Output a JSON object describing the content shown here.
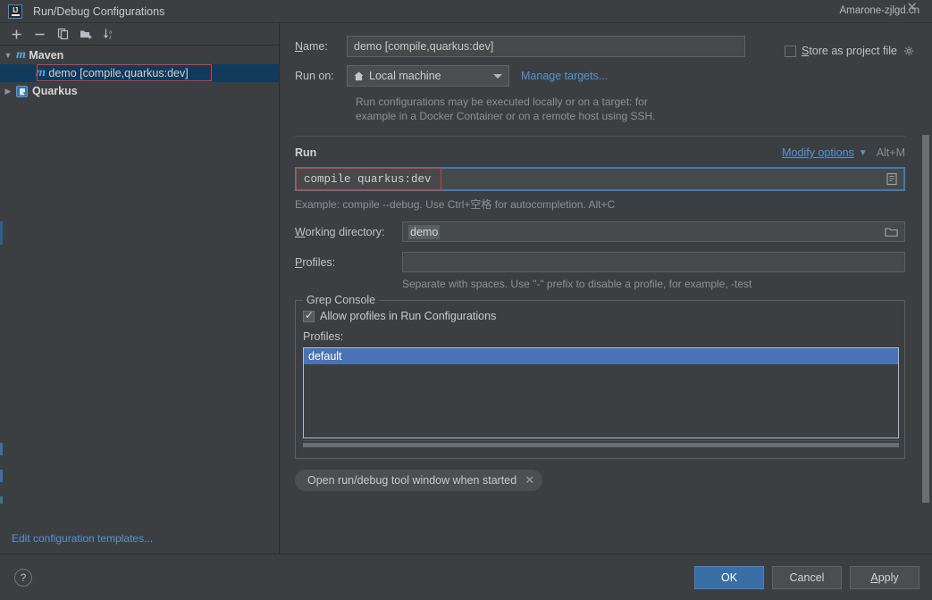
{
  "window": {
    "title": "Run/Debug Configurations",
    "app_icon": "intellij-idea-icon",
    "watermark": "Amarone-zjlgd.cn",
    "close_label": "✕"
  },
  "sidebar": {
    "toolbar": [
      {
        "name": "add-button",
        "glyph": "+"
      },
      {
        "name": "remove-button",
        "glyph": "−"
      },
      {
        "name": "copy-button",
        "glyph": "copy-icon"
      },
      {
        "name": "new-folder-button",
        "glyph": "folder-add-icon"
      },
      {
        "name": "sort-button",
        "glyph": "sort-az-icon"
      }
    ],
    "tree": [
      {
        "label": "Maven",
        "icon": "maven-icon",
        "expanded": true,
        "selected": false,
        "depth": 0
      },
      {
        "label": "demo [compile,quarkus:dev]",
        "icon": "maven-icon",
        "expanded": null,
        "selected": true,
        "depth": 1,
        "highlighted": true
      },
      {
        "label": "Quarkus",
        "icon": "quarkus-icon",
        "expanded": false,
        "selected": false,
        "depth": 0
      }
    ],
    "edit_templates_link": "Edit configuration templates..."
  },
  "form": {
    "name_label": "Name:",
    "name_value": "demo [compile,quarkus:dev]",
    "store_as_project_file_label": "Store as project file",
    "store_as_project_file_checked": false,
    "run_on_label": "Run on:",
    "run_on_value": "Local machine",
    "run_on_icon": "home-icon",
    "manage_targets_link": "Manage targets...",
    "run_on_hint_line1": "Run configurations may be executed locally or on a target: for",
    "run_on_hint_line2": "example in a Docker Container or on a remote host using SSH."
  },
  "run_section": {
    "title": "Run",
    "modify_options_link": "Modify options",
    "modify_options_shortcut": "Alt+M",
    "command_value": "compile quarkus:dev",
    "expand_icon": "expand-editor-icon",
    "example_hint": "Example: compile --debug. Use Ctrl+空格 for autocompletion. Alt+C",
    "working_directory_label": "Working directory:",
    "working_directory_value": "demo",
    "browse_icon": "folder-icon",
    "profiles_label": "Profiles:",
    "profiles_value": "",
    "profiles_hint": "Separate with spaces. Use \"-\" prefix to disable a profile, for example, -test"
  },
  "grep_console": {
    "legend": "Grep Console",
    "allow_profiles_label": "Allow profiles in Run Configurations",
    "allow_profiles_checked": true,
    "profiles_label": "Profiles:",
    "profile_items": [
      {
        "label": "default",
        "selected": true
      }
    ]
  },
  "chip": {
    "label": "Open run/debug tool window when started",
    "close_glyph": "✕"
  },
  "footer": {
    "help_glyph": "?",
    "buttons": [
      {
        "label": "OK",
        "primary": true
      },
      {
        "label": "Cancel",
        "primary": false
      },
      {
        "label": "Apply",
        "primary": false
      }
    ]
  },
  "colors": {
    "background": "#3c3f41",
    "accent_link": "#5394d4",
    "selection_blue": "#4a72b5",
    "tree_selection": "#113a5c",
    "highlight_red": "#e03a2f",
    "focus_border": "#3d7cb8"
  }
}
